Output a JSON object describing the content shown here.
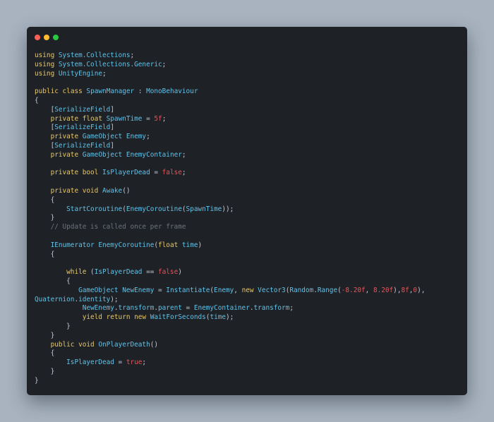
{
  "window": {
    "controls": [
      {
        "name": "close-dot",
        "color": "#fe5f57"
      },
      {
        "name": "minimize-dot",
        "color": "#febc2e"
      },
      {
        "name": "maximize-dot",
        "color": "#28c840"
      }
    ]
  },
  "colors": {
    "keyword": "#e8c86a",
    "type": "#61c2e8",
    "number": "#e0575b",
    "comment": "#6d747d",
    "plain": "#c8cdd5",
    "background": "#1e2126",
    "page_background": "#a8b3bf"
  },
  "code": {
    "lines": [
      [
        [
          "k",
          "using"
        ],
        [
          "p",
          " "
        ],
        [
          "t",
          "System.Collections"
        ],
        [
          "p",
          ";"
        ]
      ],
      [
        [
          "k",
          "using"
        ],
        [
          "p",
          " "
        ],
        [
          "t",
          "System.Collections.Generic"
        ],
        [
          "p",
          ";"
        ]
      ],
      [
        [
          "k",
          "using"
        ],
        [
          "p",
          " "
        ],
        [
          "t",
          "UnityEngine"
        ],
        [
          "p",
          ";"
        ]
      ],
      [],
      [
        [
          "k",
          "public"
        ],
        [
          "p",
          " "
        ],
        [
          "k",
          "class"
        ],
        [
          "p",
          " "
        ],
        [
          "t",
          "SpawnManager"
        ],
        [
          "p",
          " : "
        ],
        [
          "t",
          "MonoBehaviour"
        ]
      ],
      [
        [
          "p",
          "{"
        ]
      ],
      [
        [
          "p",
          "    ["
        ],
        [
          "t",
          "SerializeField"
        ],
        [
          "p",
          "]"
        ]
      ],
      [
        [
          "p",
          "    "
        ],
        [
          "k",
          "private"
        ],
        [
          "p",
          " "
        ],
        [
          "k",
          "float"
        ],
        [
          "p",
          " "
        ],
        [
          "t",
          "SpawnTime"
        ],
        [
          "p",
          " = "
        ],
        [
          "n",
          "5f"
        ],
        [
          "p",
          ";"
        ]
      ],
      [
        [
          "p",
          "    ["
        ],
        [
          "t",
          "SerializeField"
        ],
        [
          "p",
          "]"
        ]
      ],
      [
        [
          "p",
          "    "
        ],
        [
          "k",
          "private"
        ],
        [
          "p",
          " "
        ],
        [
          "t",
          "GameObject"
        ],
        [
          "p",
          " "
        ],
        [
          "t",
          "Enemy"
        ],
        [
          "p",
          ";"
        ]
      ],
      [
        [
          "p",
          "    ["
        ],
        [
          "t",
          "SerializeField"
        ],
        [
          "p",
          "]"
        ]
      ],
      [
        [
          "p",
          "    "
        ],
        [
          "k",
          "private"
        ],
        [
          "p",
          " "
        ],
        [
          "t",
          "GameObject"
        ],
        [
          "p",
          " "
        ],
        [
          "t",
          "EnemyContainer"
        ],
        [
          "p",
          ";"
        ]
      ],
      [],
      [
        [
          "p",
          "    "
        ],
        [
          "k",
          "private"
        ],
        [
          "p",
          " "
        ],
        [
          "k",
          "bool"
        ],
        [
          "p",
          " "
        ],
        [
          "t",
          "IsPlayerDead"
        ],
        [
          "p",
          " = "
        ],
        [
          "n",
          "false"
        ],
        [
          "p",
          ";"
        ]
      ],
      [],
      [
        [
          "p",
          "    "
        ],
        [
          "k",
          "private"
        ],
        [
          "p",
          " "
        ],
        [
          "k",
          "void"
        ],
        [
          "p",
          " "
        ],
        [
          "t",
          "Awake"
        ],
        [
          "p",
          "()"
        ]
      ],
      [
        [
          "p",
          "    {"
        ]
      ],
      [
        [
          "p",
          "        "
        ],
        [
          "t",
          "StartCoroutine"
        ],
        [
          "p",
          "("
        ],
        [
          "t",
          "EnemyCoroutine"
        ],
        [
          "p",
          "("
        ],
        [
          "t",
          "SpawnTime"
        ],
        [
          "p",
          "));"
        ]
      ],
      [
        [
          "p",
          "    }"
        ]
      ],
      [
        [
          "p",
          "    "
        ],
        [
          "c",
          "// Update is called once per frame"
        ]
      ],
      [],
      [
        [
          "p",
          "    "
        ],
        [
          "t",
          "IEnumerator"
        ],
        [
          "p",
          " "
        ],
        [
          "t",
          "EnemyCoroutine"
        ],
        [
          "p",
          "("
        ],
        [
          "k",
          "float"
        ],
        [
          "p",
          " "
        ],
        [
          "t",
          "time"
        ],
        [
          "p",
          ")"
        ]
      ],
      [
        [
          "p",
          "    {"
        ]
      ],
      [],
      [
        [
          "p",
          "        "
        ],
        [
          "k",
          "while"
        ],
        [
          "p",
          " ("
        ],
        [
          "t",
          "IsPlayerDead"
        ],
        [
          "p",
          " == "
        ],
        [
          "n",
          "false"
        ],
        [
          "p",
          ")"
        ]
      ],
      [
        [
          "p",
          "        {"
        ]
      ],
      [
        [
          "p",
          "           "
        ],
        [
          "t",
          "GameObject"
        ],
        [
          "p",
          " "
        ],
        [
          "t",
          "NewEnemy"
        ],
        [
          "p",
          " = "
        ],
        [
          "t",
          "Instantiate"
        ],
        [
          "p",
          "("
        ],
        [
          "t",
          "Enemy"
        ],
        [
          "p",
          ", "
        ],
        [
          "k",
          "new"
        ],
        [
          "p",
          " "
        ],
        [
          "t",
          "Vector3"
        ],
        [
          "p",
          "("
        ],
        [
          "t",
          "Random"
        ],
        [
          "p",
          "."
        ],
        [
          "t",
          "Range"
        ],
        [
          "p",
          "("
        ],
        [
          "n",
          "-8.20f"
        ],
        [
          "p",
          ", "
        ],
        [
          "n",
          "8.20f"
        ],
        [
          "p",
          "),"
        ],
        [
          "n",
          "8f"
        ],
        [
          "p",
          ","
        ],
        [
          "n",
          "0"
        ],
        [
          "p",
          "),"
        ]
      ],
      [
        [
          "t",
          "Quaternion"
        ],
        [
          "p",
          "."
        ],
        [
          "t",
          "identity"
        ],
        [
          "p",
          ");"
        ]
      ],
      [
        [
          "p",
          "            "
        ],
        [
          "t",
          "NewEnemy"
        ],
        [
          "p",
          "."
        ],
        [
          "t",
          "transform"
        ],
        [
          "p",
          "."
        ],
        [
          "t",
          "parent"
        ],
        [
          "p",
          " = "
        ],
        [
          "t",
          "EnemyContainer"
        ],
        [
          "p",
          "."
        ],
        [
          "t",
          "transform"
        ],
        [
          "p",
          ";"
        ]
      ],
      [
        [
          "p",
          "            "
        ],
        [
          "k",
          "yield"
        ],
        [
          "p",
          " "
        ],
        [
          "k",
          "return"
        ],
        [
          "p",
          " "
        ],
        [
          "k",
          "new"
        ],
        [
          "p",
          " "
        ],
        [
          "t",
          "WaitForSeconds"
        ],
        [
          "p",
          "("
        ],
        [
          "t",
          "time"
        ],
        [
          "p",
          ");"
        ]
      ],
      [
        [
          "p",
          "        }"
        ]
      ],
      [
        [
          "p",
          "    }"
        ]
      ],
      [
        [
          "p",
          "    "
        ],
        [
          "k",
          "public"
        ],
        [
          "p",
          " "
        ],
        [
          "k",
          "void"
        ],
        [
          "p",
          " "
        ],
        [
          "t",
          "OnPlayerDeath"
        ],
        [
          "p",
          "()"
        ]
      ],
      [
        [
          "p",
          "    {"
        ]
      ],
      [
        [
          "p",
          "        "
        ],
        [
          "t",
          "IsPlayerDead"
        ],
        [
          "p",
          " = "
        ],
        [
          "n",
          "true"
        ],
        [
          "p",
          ";"
        ]
      ],
      [
        [
          "p",
          "    }"
        ]
      ],
      [
        [
          "p",
          "}"
        ]
      ]
    ]
  }
}
